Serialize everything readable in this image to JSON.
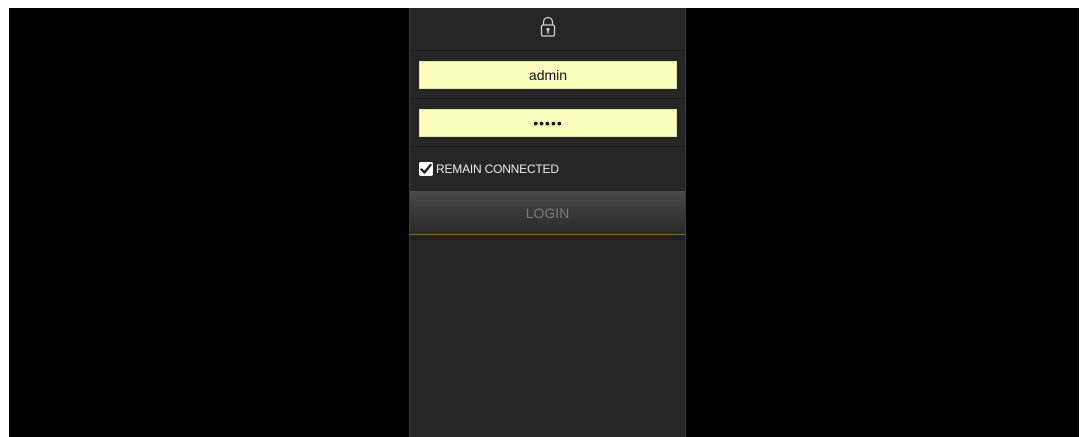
{
  "login": {
    "username_value": "admin",
    "password_value": "•••••",
    "remember_label": "REMAIN CONNECTED",
    "remember_checked": true,
    "login_label": "LOGIN"
  },
  "icons": {
    "lock": "lock-icon",
    "check": "check-icon"
  },
  "colors": {
    "background": "#000000",
    "panel": "#262626",
    "field_bg": "#fafdbc",
    "button_text": "#7a7a7a",
    "accent_line": "#8a6a12"
  }
}
